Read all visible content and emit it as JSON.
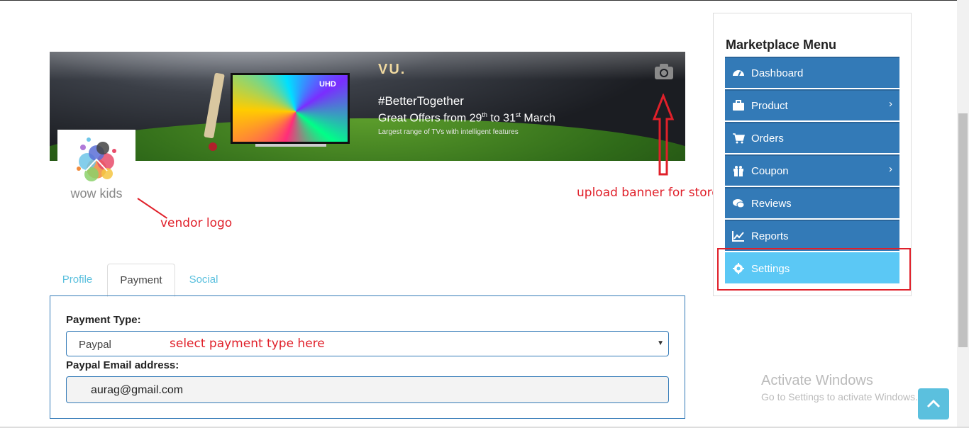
{
  "banner": {
    "brand": "VU.",
    "uhd_badge": "UHD",
    "headline": "#BetterTogether",
    "offer": "Great Offers from 29th to 31st March",
    "tagline": "Largest range of TVs with intelligent features",
    "camera_icon": "camera-icon"
  },
  "vendor_logo": {
    "text": "wow kids"
  },
  "annotations": {
    "vendor_logo": "vendor logo",
    "upload_banner": "upload banner for store",
    "payment_type": "select payment type here"
  },
  "tabs": [
    {
      "label": "Profile",
      "active": false
    },
    {
      "label": "Payment",
      "active": true
    },
    {
      "label": "Social",
      "active": false
    }
  ],
  "payment": {
    "type_label": "Payment Type:",
    "type_value": "Paypal",
    "email_label": "Paypal Email address:",
    "email_value": "aurag@gmail.com"
  },
  "sidebar": {
    "title": "Marketplace Menu",
    "items": [
      {
        "label": "Dashboard",
        "icon": "dashboard-icon",
        "has_submenu": false,
        "chev": ""
      },
      {
        "label": "Product",
        "icon": "briefcase-icon",
        "has_submenu": true,
        "chev": "›"
      },
      {
        "label": "Orders",
        "icon": "cart-icon",
        "has_submenu": false,
        "chev": ""
      },
      {
        "label": "Coupon",
        "icon": "gift-icon",
        "has_submenu": true,
        "chev": "›"
      },
      {
        "label": "Reviews",
        "icon": "comments-icon",
        "has_submenu": false,
        "chev": ""
      },
      {
        "label": "Reports",
        "icon": "chart-line-icon",
        "has_submenu": false,
        "chev": ""
      },
      {
        "label": "Settings",
        "icon": "gear-icon",
        "has_submenu": false,
        "chev": "",
        "active": true
      }
    ]
  },
  "windows": {
    "line1": "Activate Windows",
    "line2": "Go to Settings to activate Windows."
  },
  "colors": {
    "primary": "#337ab7",
    "active": "#5bc8f5",
    "annotation": "#e0202a",
    "tab_link": "#5bc0de"
  }
}
